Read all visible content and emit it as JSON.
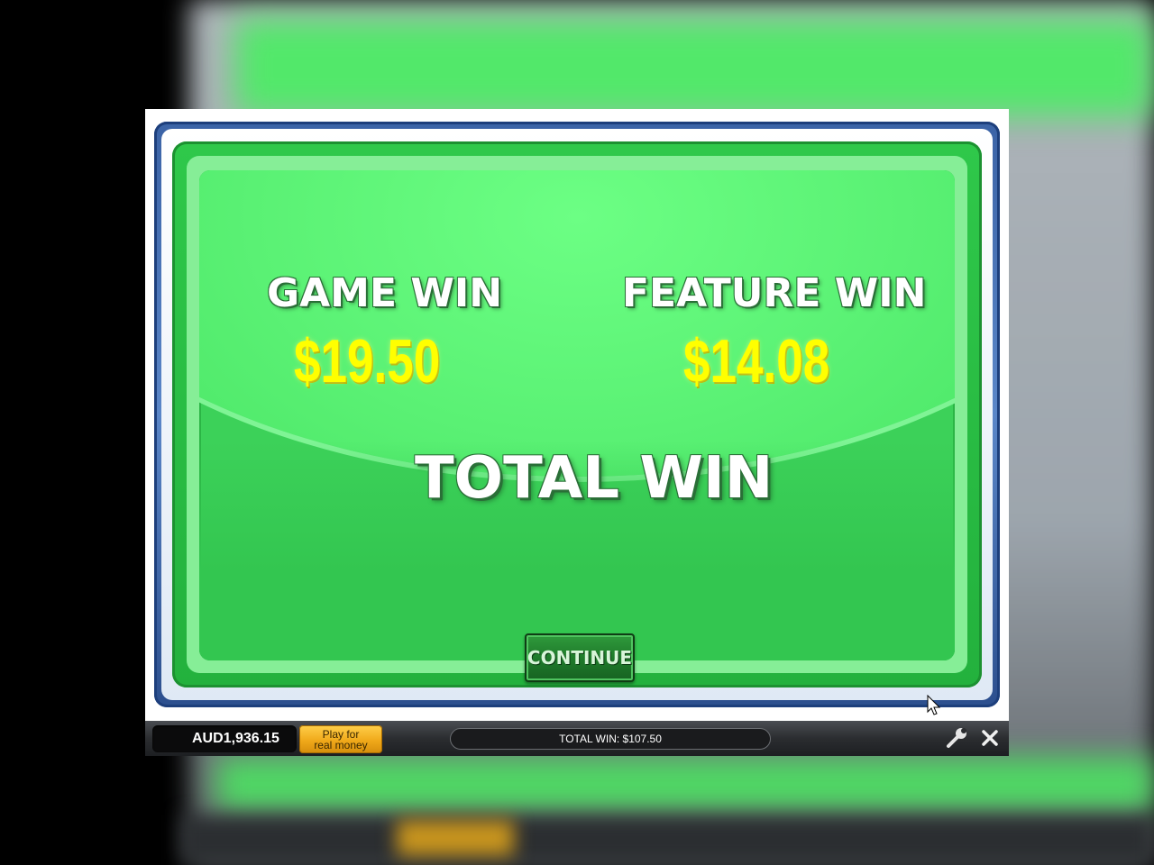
{
  "panel": {
    "game_win_label": "GAME WIN",
    "game_win_value": "$19.50",
    "feature_win_label": "FEATURE WIN",
    "feature_win_value": "$14.08",
    "total_win_label": "TOTAL WIN",
    "continue_label": "CONTINUE"
  },
  "bottom_bar": {
    "balance": "AUD1,936.15",
    "real_money_line1": "Play for",
    "real_money_line2": "real money",
    "total_win_text": "TOTAL WIN: $107.50",
    "tools_icon": "wrench-icon",
    "close_icon": "close-icon"
  },
  "colors": {
    "panel_green": "#3cd159",
    "value_yellow": "#ffff00",
    "frame_blue": "#3b63a6",
    "button_gold": "#f0a91a"
  }
}
